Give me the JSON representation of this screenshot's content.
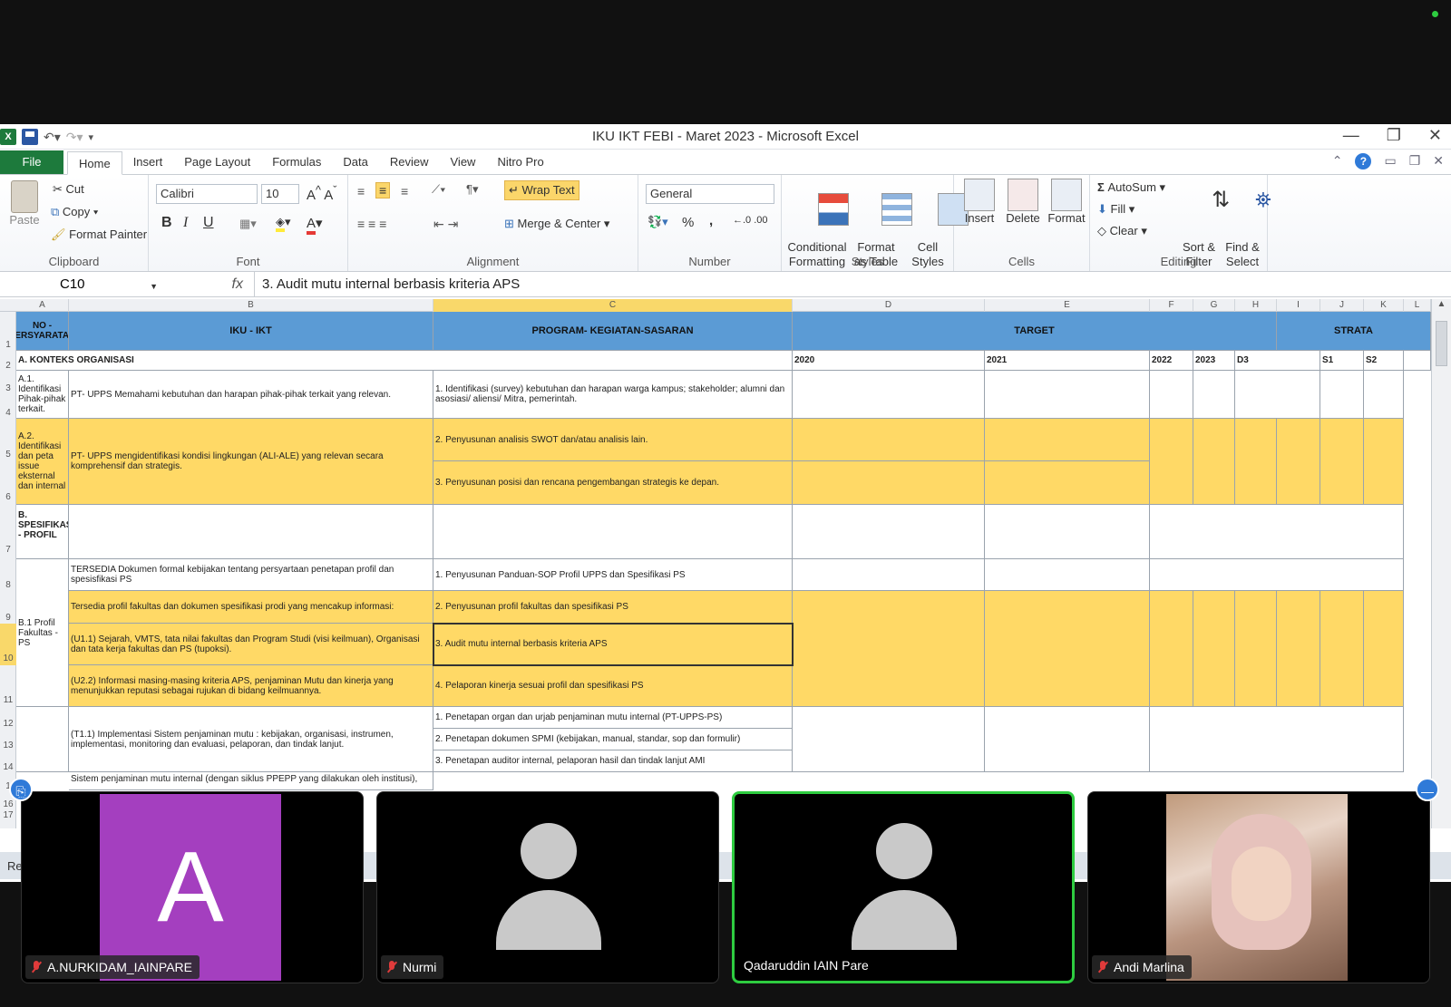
{
  "window": {
    "title": "IKU IKT FEBI - Maret 2023 - Microsoft Excel"
  },
  "ribbon_tabs": [
    "File",
    "Home",
    "Insert",
    "Page Layout",
    "Formulas",
    "Data",
    "Review",
    "View",
    "Nitro Pro"
  ],
  "clipboard": {
    "paste": "Paste",
    "cut": "Cut",
    "copy": "Copy",
    "format_painter": "Format Painter",
    "label": "Clipboard"
  },
  "font": {
    "name": "Calibri",
    "size": "10",
    "bold": "B",
    "italic": "I",
    "underline": "U",
    "label": "Font"
  },
  "alignment": {
    "wrap_text": "Wrap Text",
    "merge_center": "Merge & Center",
    "label": "Alignment"
  },
  "number": {
    "format": "General",
    "percent": "%",
    "comma": ",",
    "label": "Number"
  },
  "styles": {
    "conditional": "Conditional\nFormatting",
    "format_table": "Format\nas Table",
    "cell_styles": "Cell\nStyles",
    "label": "Styles"
  },
  "cells": {
    "insert": "Insert",
    "delete": "Delete",
    "format": "Format",
    "label": "Cells"
  },
  "editing": {
    "autosum": "AutoSum",
    "fill": "Fill",
    "clear": "Clear",
    "sort_filter": "Sort &\nFilter",
    "find_select": "Find &\nSelect",
    "label": "Editing"
  },
  "formula_bar": {
    "name_box": "C10",
    "fx": "fx",
    "formula": "3.     Audit mutu internal berbasis kriteria APS"
  },
  "columns": [
    "A",
    "B",
    "C",
    "D",
    "E",
    "F",
    "G",
    "H",
    "I",
    "J",
    "K",
    "L"
  ],
  "rows": [
    "1",
    "2",
    "3",
    "4",
    "5",
    "6",
    "7",
    "8",
    "9",
    "10",
    "11",
    "12",
    "13",
    "14",
    "1",
    "16",
    "17"
  ],
  "sheet": {
    "h_no": "NO - PERSYARATAN",
    "h_iku": "IKU - IKT",
    "h_program": "PROGRAM- KEGIATAN-SASARAN",
    "h_target": "TARGET",
    "h_strata": "STRATA",
    "sec_a": "A.   KONTEKS ORGANISASI",
    "y2020": "2020",
    "y2021": "2021",
    "y2022": "2022",
    "y2023": "2023",
    "d3": "D3",
    "s1": "S1",
    "s2": "S2",
    "a1": "A.1. Identifikasi Pihak-pihak terkait.",
    "a1_iku": "PT- UPPS Memahami kebutuhan dan harapan pihak-pihak terkait yang relevan.",
    "a1_prog": "1.   Identifikasi (survey) kebutuhan dan harapan warga kampus; stakeholder; alumni dan asosiasi/ aliensi/ Mitra, pemerintah.",
    "a2": "A.2. Identifikasi dan peta issue eksternal dan internal",
    "a2_iku": "PT- UPPS mengidentifikasi kondisi lingkungan (ALI-ALE) yang relevan secara komprehensif dan strategis.",
    "a2_prog1": "2.   Penyusunan analisis SWOT dan/atau analisis lain.",
    "a2_prog2": "3.   Penyusunan posisi dan rencana pengembangan strategis ke depan.",
    "sec_b": "B. SPESIFIKASI - PROFIL",
    "b1": "B.1 Profil Fakultas - PS",
    "r8_iku": "TERSEDIA Dokumen formal kebijakan tentang persyartaan penetapan profil dan spesisfikasi PS",
    "r8_prog": "1.   Penyusunan Panduan-SOP Profil UPPS dan Spesifikasi PS",
    "r9_iku": "Tersedia profil fakultas dan dokumen spesifikasi prodi yang mencakup informasi:",
    "r9_prog": "2.   Penyusunan profil fakultas dan spesifikasi PS",
    "r10_iku": "(U1.1)  Sejarah, VMTS, tata nilai fakultas dan Program Studi (visi keilmuan), Organisasi dan tata kerja fakultas dan PS (tupoksi).",
    "r10_prog": "3.     Audit mutu internal berbasis kriteria APS",
    "r11_iku": "(U2.2)  Informasi masing-masing kriteria APS, penjaminan Mutu dan kinerja yang menunjukkan reputasi sebagai rujukan di bidang keilmuannya.",
    "r11_prog": "4.   Pelaporan kinerja sesuai profil dan spesifikasi PS",
    "r12_iku": "(T1.1)  Implementasi Sistem penjaminan mutu : kebijakan, organisasi, instrumen, implementasi, monitoring dan evaluasi, pelaporan, dan tindak lanjut.",
    "r12_prog": "1.   Penetapan organ dan urjab penjaminan mutu internal (PT-UPPS-PS)",
    "r13_prog": "2.   Penetapan dokumen SPMI (kebijakan, manual, standar, sop dan formulir)",
    "r14_prog": "3.   Penetapan auditor internal, pelaporan hasil dan tindak lanjut AMI",
    "r15_iku": "Sistem penjaminan mutu internal (dengan siklus PPEPP yang dilakukan oleh institusi),"
  },
  "status_bar": "Re",
  "participants": [
    {
      "name": "A.NURKIDAM_IAINPARE",
      "initial": "A",
      "muted": true,
      "color": "#a43fbf"
    },
    {
      "name": "Nurmi",
      "muted": true
    },
    {
      "name": "Qadaruddin IAIN Pare",
      "muted": false,
      "active": true
    },
    {
      "name": "Andi Marlina",
      "muted": true
    }
  ],
  "colors": {
    "header_blue": "#5b9bd5",
    "highlight_yellow": "#ffd966",
    "excel_green": "#1d7a3c",
    "active_speaker": "#2ecc40"
  }
}
